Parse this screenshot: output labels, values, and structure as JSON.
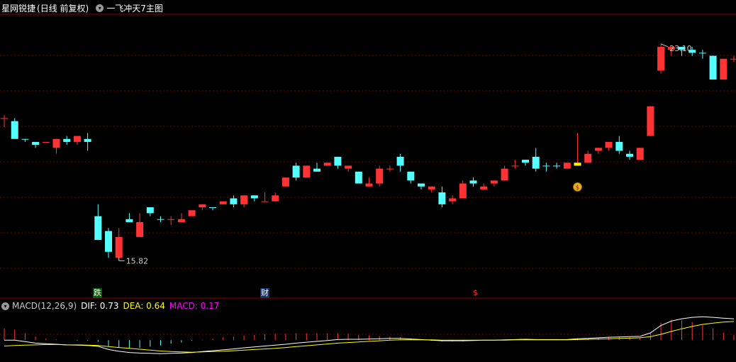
{
  "header": {
    "app": "星网锐捷",
    "mode": "(日线 前复权)",
    "indicator": "一飞冲天7主图"
  },
  "macd_header": {
    "name": "MACD(12,26,9)",
    "dif_label": "DIF: 0.73",
    "dea_label": "DEA: 0.64",
    "macd_label": "MACD: 0.17"
  },
  "events": {
    "down": "跌",
    "finance": "财",
    "dollar": "$"
  },
  "colors": {
    "up": "#ff3333",
    "down": "#54ffff",
    "signal": "#ffff00",
    "dif": "#ffffff",
    "dea": "#ffff00",
    "macd": "#ff00ff",
    "grid": "#7a0000"
  },
  "chart_data": [
    {
      "type": "candlestick",
      "title": "",
      "ylim": [
        14.9,
        24.1
      ],
      "max_label": "23.10",
      "min_label": "15.82",
      "candles": [
        [
          20.6,
          20.6,
          20.7,
          20.3,
          1
        ],
        [
          20.5,
          19.9,
          20.6,
          19.9,
          0
        ],
        [
          19.9,
          19.9,
          19.9,
          19.8,
          0
        ],
        [
          19.8,
          19.7,
          19.8,
          19.6,
          0
        ],
        [
          19.8,
          19.8,
          19.8,
          19.8,
          1
        ],
        [
          19.6,
          19.9,
          19.9,
          19.4,
          1
        ],
        [
          19.8,
          19.9,
          20.0,
          19.7,
          0
        ],
        [
          19.8,
          20.0,
          20.0,
          19.7,
          1
        ],
        [
          19.9,
          19.8,
          20.1,
          19.5,
          0
        ],
        [
          17.3,
          16.5,
          17.7,
          16.5,
          0
        ],
        [
          16.8,
          16.1,
          16.9,
          15.9,
          0
        ],
        [
          15.9,
          16.6,
          16.9,
          15.8,
          1
        ],
        [
          17.2,
          17.1,
          17.4,
          17.1,
          0
        ],
        [
          16.6,
          17.1,
          17.4,
          16.6,
          1
        ],
        [
          17.6,
          17.4,
          17.6,
          17.3,
          0
        ],
        [
          17.2,
          17.2,
          17.3,
          17.1,
          0
        ],
        [
          17.2,
          17.2,
          17.3,
          17.0,
          1
        ],
        [
          17.1,
          17.2,
          17.4,
          17.1,
          1
        ],
        [
          17.3,
          17.5,
          17.4,
          17.3,
          1
        ],
        [
          17.6,
          17.7,
          17.7,
          17.5,
          1
        ],
        [
          17.6,
          17.6,
          17.6,
          17.5,
          0
        ],
        [
          17.7,
          17.8,
          17.8,
          17.7,
          1
        ],
        [
          17.9,
          17.7,
          18.0,
          17.6,
          0
        ],
        [
          17.7,
          18.0,
          18.0,
          17.6,
          1
        ],
        [
          18.0,
          17.9,
          18.0,
          17.8,
          0
        ],
        [
          17.8,
          17.8,
          18.1,
          17.8,
          1
        ],
        [
          17.8,
          18.0,
          18.1,
          17.8,
          1
        ],
        [
          18.3,
          18.6,
          18.6,
          18.3,
          1
        ],
        [
          19.0,
          18.6,
          19.1,
          18.5,
          0
        ],
        [
          18.6,
          19.0,
          19.0,
          18.6,
          1
        ],
        [
          18.8,
          18.9,
          19.1,
          18.8,
          0
        ],
        [
          19.0,
          19.1,
          19.1,
          19.0,
          1
        ],
        [
          19.3,
          19.0,
          19.3,
          18.9,
          0
        ],
        [
          19.0,
          18.9,
          19.0,
          18.8,
          1
        ],
        [
          18.8,
          18.4,
          18.8,
          18.4,
          0
        ],
        [
          18.3,
          18.4,
          18.6,
          18.3,
          1
        ],
        [
          18.4,
          18.9,
          19.0,
          18.3,
          1
        ],
        [
          18.9,
          18.9,
          19.0,
          18.8,
          1
        ],
        [
          19.3,
          19.0,
          19.4,
          18.8,
          0
        ],
        [
          18.8,
          18.5,
          18.8,
          18.4,
          0
        ],
        [
          18.4,
          18.3,
          18.4,
          18.2,
          0
        ],
        [
          18.3,
          18.2,
          18.3,
          18.1,
          1
        ],
        [
          18.1,
          17.7,
          18.3,
          17.6,
          0
        ],
        [
          17.8,
          17.9,
          18.0,
          17.7,
          1
        ],
        [
          17.9,
          18.4,
          18.5,
          17.9,
          1
        ],
        [
          18.4,
          18.5,
          18.6,
          18.3,
          0
        ],
        [
          18.2,
          18.3,
          18.4,
          18.2,
          1
        ],
        [
          18.4,
          18.5,
          18.5,
          18.3,
          1
        ],
        [
          18.5,
          18.9,
          19.0,
          18.5,
          1
        ],
        [
          19.0,
          19.0,
          19.2,
          18.9,
          1
        ],
        [
          19.1,
          19.2,
          19.2,
          19.0,
          0
        ],
        [
          19.3,
          18.9,
          19.6,
          18.8,
          0
        ],
        [
          19.0,
          19.0,
          19.1,
          18.8,
          0
        ],
        [
          19.0,
          19.0,
          19.1,
          18.9,
          0
        ],
        [
          18.9,
          19.1,
          19.1,
          18.9,
          1
        ],
        [
          19.0,
          19.1,
          20.1,
          19.0,
          2
        ],
        [
          19.1,
          19.4,
          19.5,
          19.1,
          1
        ],
        [
          19.5,
          19.6,
          19.6,
          19.4,
          1
        ],
        [
          19.6,
          19.8,
          19.8,
          19.5,
          1
        ],
        [
          19.8,
          19.5,
          20.0,
          19.4,
          0
        ],
        [
          19.4,
          19.3,
          19.5,
          19.2,
          0
        ],
        [
          19.2,
          19.6,
          19.6,
          19.2,
          1
        ],
        [
          20.0,
          21.0,
          21.0,
          20.0,
          1
        ],
        [
          22.2,
          23.0,
          23.1,
          22.1,
          1
        ],
        [
          22.9,
          23.0,
          23.0,
          22.7,
          1
        ],
        [
          23.0,
          22.9,
          23.0,
          22.7,
          0
        ],
        [
          22.9,
          22.8,
          23.0,
          22.7,
          0
        ],
        [
          22.8,
          22.8,
          22.9,
          22.6,
          0
        ],
        [
          22.7,
          21.9,
          22.7,
          21.9,
          0
        ],
        [
          21.9,
          22.6,
          22.6,
          21.9,
          1
        ],
        [
          22.6,
          22.6,
          22.7,
          22.5,
          1
        ]
      ]
    },
    {
      "type": "line",
      "title": "",
      "ylim": [
        -0.6,
        1.0
      ],
      "series": [
        {
          "name": "DIF",
          "values": [
            0.0,
            0.0,
            -0.05,
            -0.1,
            -0.12,
            -0.14,
            -0.16,
            -0.17,
            -0.18,
            -0.21,
            -0.32,
            -0.38,
            -0.42,
            -0.44,
            -0.45,
            -0.46,
            -0.45,
            -0.44,
            -0.42,
            -0.39,
            -0.36,
            -0.33,
            -0.3,
            -0.26,
            -0.23,
            -0.2,
            -0.17,
            -0.14,
            -0.1,
            -0.07,
            -0.04,
            -0.01,
            0.02,
            0.03,
            0.03,
            0.04,
            0.05,
            0.06,
            0.06,
            0.04,
            0.02,
            0.0,
            -0.02,
            -0.02,
            -0.02,
            -0.01,
            0.0,
            0.0,
            0.01,
            0.02,
            0.03,
            0.02,
            0.02,
            0.02,
            0.02,
            0.05,
            0.06,
            0.08,
            0.1,
            0.11,
            0.12,
            0.13,
            0.25,
            0.5,
            0.65,
            0.73,
            0.78,
            0.8,
            0.78,
            0.75,
            0.73
          ]
        },
        {
          "name": "DEA",
          "values": [
            -0.2,
            -0.18,
            -0.17,
            -0.16,
            -0.15,
            -0.15,
            -0.16,
            -0.16,
            -0.17,
            -0.18,
            -0.22,
            -0.25,
            -0.28,
            -0.31,
            -0.34,
            -0.37,
            -0.39,
            -0.4,
            -0.41,
            -0.4,
            -0.39,
            -0.38,
            -0.36,
            -0.34,
            -0.32,
            -0.3,
            -0.28,
            -0.25,
            -0.22,
            -0.19,
            -0.16,
            -0.13,
            -0.1,
            -0.08,
            -0.06,
            -0.04,
            -0.02,
            0.0,
            0.01,
            0.01,
            0.01,
            0.01,
            0.0,
            0.0,
            0.0,
            0.0,
            0.0,
            0.0,
            0.0,
            0.01,
            0.01,
            0.01,
            0.01,
            0.01,
            0.01,
            0.02,
            0.03,
            0.04,
            0.05,
            0.06,
            0.07,
            0.08,
            0.12,
            0.2,
            0.3,
            0.39,
            0.47,
            0.54,
            0.58,
            0.62,
            0.64
          ]
        }
      ],
      "bars": {
        "name": "MACD",
        "values": [
          0.4,
          0.36,
          0.24,
          0.12,
          0.06,
          0.02,
          0.0,
          -0.02,
          -0.02,
          -0.06,
          -0.2,
          -0.26,
          -0.28,
          -0.26,
          -0.22,
          -0.18,
          -0.12,
          -0.08,
          -0.02,
          0.02,
          0.06,
          0.1,
          0.12,
          0.16,
          0.18,
          0.2,
          0.22,
          0.22,
          0.24,
          0.24,
          0.24,
          0.24,
          0.24,
          0.22,
          0.18,
          0.16,
          0.14,
          0.12,
          0.1,
          0.06,
          0.02,
          -0.02,
          -0.04,
          -0.04,
          -0.04,
          -0.02,
          0.0,
          0.0,
          0.02,
          0.02,
          0.04,
          0.02,
          0.02,
          0.02,
          0.02,
          0.06,
          0.06,
          0.08,
          0.1,
          0.1,
          0.1,
          0.1,
          0.26,
          0.6,
          0.7,
          0.68,
          0.62,
          0.52,
          0.4,
          0.26,
          0.17
        ]
      }
    }
  ]
}
